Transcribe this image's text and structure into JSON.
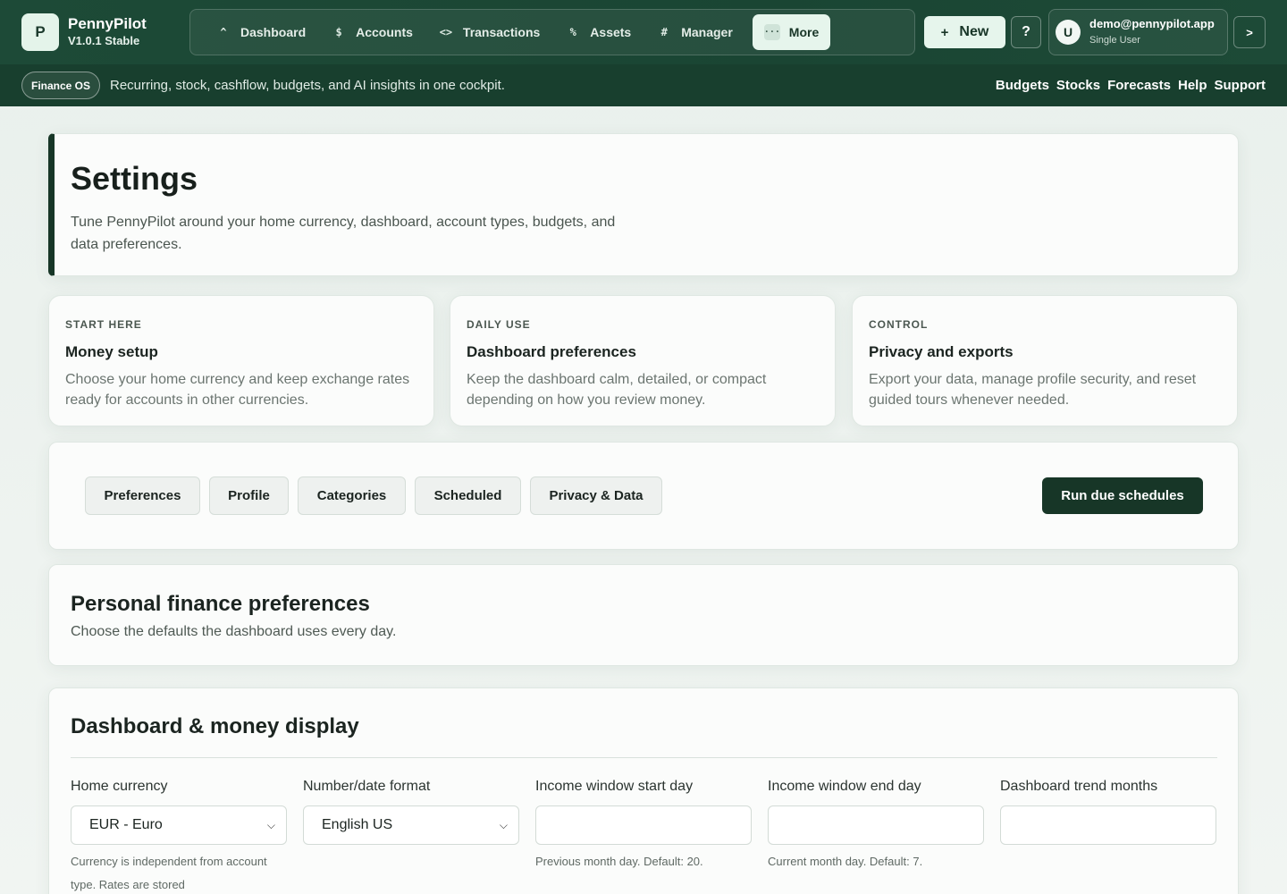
{
  "brand": {
    "logo_letter": "P",
    "name": "PennyPilot",
    "version": "V1.0.1 Stable"
  },
  "nav": {
    "items": [
      {
        "glyph": "^",
        "label": "Dashboard"
      },
      {
        "glyph": "$",
        "label": "Accounts"
      },
      {
        "glyph": "<>",
        "label": "Transactions"
      },
      {
        "glyph": "%",
        "label": "Assets"
      },
      {
        "glyph": "#",
        "label": "Manager"
      },
      {
        "glyph": "...",
        "label": "More"
      }
    ]
  },
  "header": {
    "new_plus": "+",
    "new_label": "New",
    "help_label": "?",
    "user_initial": "U",
    "user_email": "demo@pennypilot.app",
    "user_role": "Single User",
    "expand_label": ">"
  },
  "subbar": {
    "chip": "Finance OS",
    "tagline": "Recurring, stock, cashflow, budgets, and AI insights in one cockpit.",
    "links": [
      "Budgets",
      "Stocks",
      "Forecasts",
      "Help",
      "Support"
    ]
  },
  "hero": {
    "title": "Settings",
    "description": "Tune PennyPilot around your home currency, dashboard, account types, budgets, and data preferences."
  },
  "info_cards": [
    {
      "eyebrow": "START HERE",
      "title": "Money setup",
      "desc": "Choose your home currency and keep exchange rates ready for accounts in other currencies."
    },
    {
      "eyebrow": "DAILY USE",
      "title": "Dashboard preferences",
      "desc": "Keep the dashboard calm, detailed, or compact depending on how you review money."
    },
    {
      "eyebrow": "CONTROL",
      "title": "Privacy and exports",
      "desc": "Export your data, manage profile security, and reset guided tours whenever needed."
    }
  ],
  "tabs": [
    "Preferences",
    "Profile",
    "Categories",
    "Scheduled",
    "Privacy & Data"
  ],
  "run_button": "Run due schedules",
  "preferences": {
    "title": "Personal finance preferences",
    "subtitle": "Choose the defaults the dashboard uses every day."
  },
  "dashboard": {
    "title": "Dashboard & money display",
    "fields": [
      {
        "label": "Home currency",
        "value": "EUR - Euro",
        "help": "Currency is independent from account type. Rates are stored"
      },
      {
        "label": "Number/date format",
        "value": "English US",
        "help": ""
      },
      {
        "label": "Income window start day",
        "value": "",
        "help": "Previous month day. Default: 20."
      },
      {
        "label": "Income window end day",
        "value": "",
        "help": "Current month day. Default: 7."
      },
      {
        "label": "Dashboard trend months",
        "value": "",
        "help": ""
      }
    ]
  }
}
